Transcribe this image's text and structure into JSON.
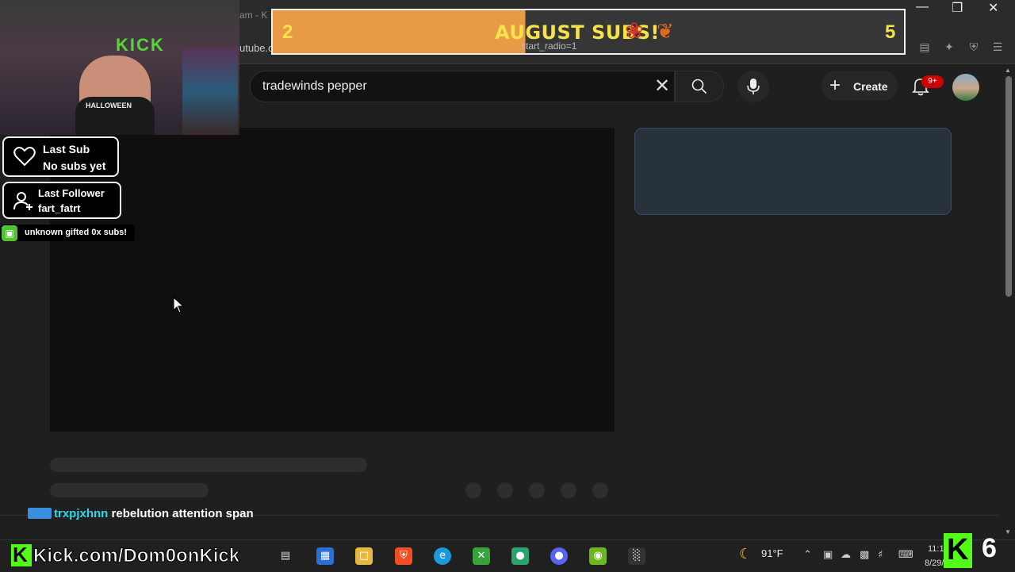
{
  "browser": {
    "tab_fragment": "am - K",
    "url_fragment": "utube.c",
    "window_controls": [
      "minimize",
      "restore",
      "close"
    ],
    "extension_icons": [
      "cast-icon",
      "share-icon",
      "brave-shield-icon",
      "brave-rewards-icon",
      "puzzle-icon",
      "screenshot-icon",
      "music-icon",
      "sidebar-icon",
      "wallet-icon",
      "leo-icon",
      "vpn-icon",
      "menu-icon"
    ]
  },
  "goal_banner": {
    "left_count": "2",
    "title": "AUGUST SUBS!",
    "right_count": "5",
    "overlapping_url_text": "start_radio=1",
    "fill_fraction": 0.4
  },
  "youtube": {
    "search_value": "tradewinds pepper",
    "create_label": "Create",
    "notification_badge": "9+"
  },
  "overlay": {
    "webcam_sign": "KICK",
    "webcam_shirt": "HALLOWEEN",
    "last_sub_title": "Last Sub",
    "last_sub_value": "No subs yet",
    "last_follower_title": "Last Follower",
    "last_follower_value": "fart_fatrt",
    "gift_text": "unknown gifted 0x subs!",
    "chat_user": "trxpjxhnn",
    "chat_message": "rebelution attention span",
    "chat_user_color": "#2fd7e8"
  },
  "taskbar": {
    "stream_url": "Kick.com/Dom0onKick",
    "temperature": "91°F",
    "clock_time": "11:1",
    "clock_date": "8/29/2025",
    "viewer_count": "6",
    "apps": [
      "task-view",
      "store",
      "file-explorer",
      "brave",
      "edge",
      "xbox",
      "chat-app",
      "discord",
      "nvidia",
      "chart-app"
    ]
  },
  "colors": {
    "kick_green": "#53fc18",
    "banner_orange": "#e89a45",
    "banner_text": "#f6e24a",
    "yt_background": "#1f1f1f"
  }
}
